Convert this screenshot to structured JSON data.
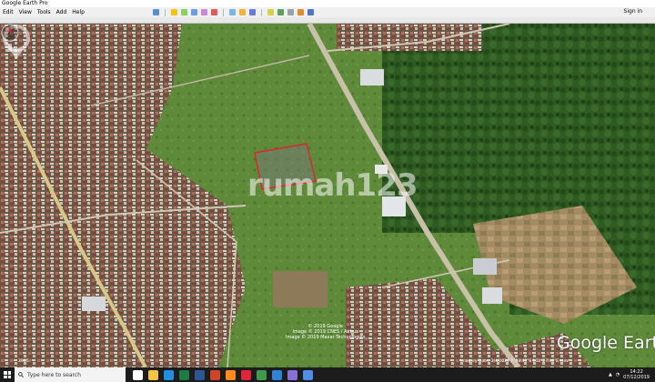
{
  "window": {
    "title": "Google Earth Pro"
  },
  "menu": [
    {
      "label": "Edit"
    },
    {
      "label": "View"
    },
    {
      "label": "Tools"
    },
    {
      "label": "Add"
    },
    {
      "label": "Help"
    }
  ],
  "toolbar": {
    "signin_label": "Sign in",
    "tools": [
      "show-sidebar-icon",
      "placemark-icon",
      "polygon-icon",
      "path-icon",
      "image-overlay-icon",
      "record-tour-icon",
      "historical-imagery-icon",
      "sun-icon",
      "planets-icon",
      "ruler-icon",
      "email-icon",
      "print-icon",
      "save-image-icon",
      "maps-icon"
    ]
  },
  "map": {
    "watermark": "rumah123",
    "logo": "Google Earth",
    "copyright_lines": [
      "© 2019 Google",
      "Image © 2019 CNES / Airbus",
      "Image © 2019 Maxar Technologies"
    ],
    "status_text": "Imagery Date: 2/4/2020   1°18'40\"S  103°27'46\"E  elev",
    "eye_alt": "elev",
    "scale_left": "2905",
    "highlight_color": "#e0242c"
  },
  "taskbar": {
    "search_placeholder": "Type here to search",
    "time": "14:22",
    "date": "07/12/2019",
    "apps": [
      {
        "name": "task-view-icon",
        "color": "#ffffff"
      },
      {
        "name": "file-explorer-icon",
        "color": "#f4c542"
      },
      {
        "name": "edge-icon",
        "color": "#1f8fe0"
      },
      {
        "name": "excel-icon",
        "color": "#1e7b45"
      },
      {
        "name": "word-icon",
        "color": "#2b5797"
      },
      {
        "name": "powerpoint-icon",
        "color": "#d04525"
      },
      {
        "name": "firefox-icon",
        "color": "#ff8a1c"
      },
      {
        "name": "opera-icon",
        "color": "#e0243a"
      },
      {
        "name": "chrome-icon",
        "color": "#3e9b4e"
      },
      {
        "name": "ie-icon",
        "color": "#2b84d8"
      },
      {
        "name": "photos-icon",
        "color": "#8a6fd6"
      },
      {
        "name": "google-earth-icon",
        "color": "#4b8fe8"
      }
    ]
  }
}
